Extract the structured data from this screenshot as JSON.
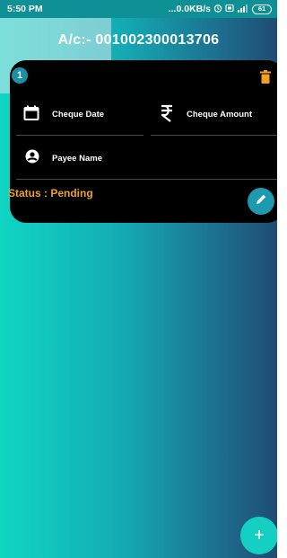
{
  "status_bar": {
    "time": "5:50 PM",
    "network_speed": "...0.0KB/s",
    "battery_level": "61",
    "icons": [
      "alarm-icon",
      "sim-icon",
      "signal-icon",
      "battery-icon"
    ]
  },
  "header": {
    "account_title": "A/c:- 001002300013706"
  },
  "card": {
    "index": "1",
    "cheque_date_label": "Cheque Date",
    "cheque_amount_label": "Cheque Amount",
    "payee_name_label": "Payee Name",
    "status_text": "Status : Pending"
  },
  "fab": {
    "label": "+"
  },
  "colors": {
    "accent_teal": "#15d0c2",
    "card_background": "#000000",
    "status_pending": "#f2a11f",
    "trash_icon": "#f2a11f"
  }
}
